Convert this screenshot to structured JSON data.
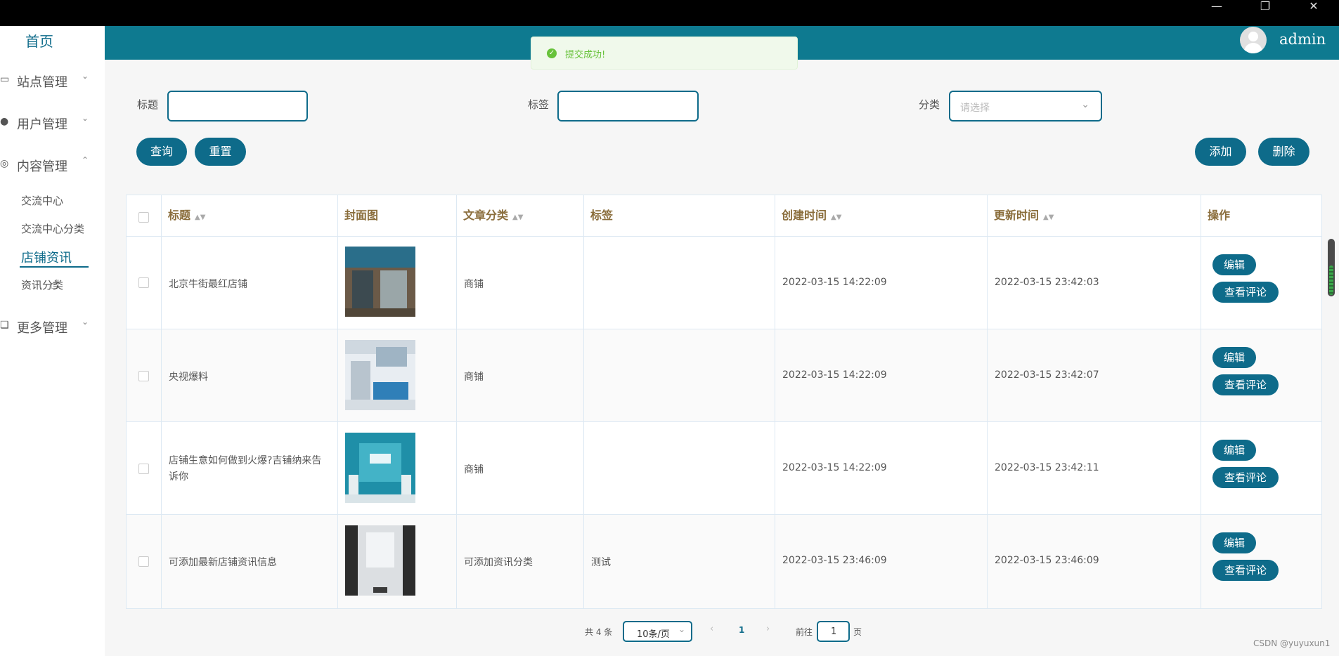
{
  "window": {
    "minimize": "—",
    "restore": "❐",
    "close": "✕"
  },
  "sidebar": {
    "home": "首页",
    "menus": [
      {
        "label": "站点管理",
        "icon": "monitor-icon",
        "glyph": "▭",
        "arrow": "⌄"
      },
      {
        "label": "用户管理",
        "icon": "user-icon",
        "glyph": "●",
        "arrow": "⌄"
      },
      {
        "label": "内容管理",
        "icon": "chat-icon",
        "glyph": "◎",
        "arrow": "⌃"
      },
      {
        "label": "更多管理",
        "icon": "copy-icon",
        "glyph": "❏",
        "arrow": "⌄"
      }
    ],
    "sub_items": [
      "交流中心",
      "交流中心分类",
      "店铺资讯",
      "资讯分类"
    ]
  },
  "header": {
    "user": "admin"
  },
  "toast": {
    "message": "提交成功!"
  },
  "filters": {
    "title_label": "标题",
    "tag_label": "标签",
    "category_label": "分类",
    "category_placeholder": "请选择"
  },
  "buttons": {
    "query": "查询",
    "reset": "重置",
    "add": "添加",
    "delete": "删除"
  },
  "table": {
    "headers": [
      "标题",
      "封面图",
      "文章分类",
      "标签",
      "创建时间",
      "更新时间",
      "操作"
    ],
    "rows": [
      {
        "title": "北京牛街最红店铺",
        "category": "商铺",
        "tag": "",
        "created": "2022-03-15 14:22:09",
        "updated": "2022-03-15 23:42:03"
      },
      {
        "title": "央视爆料",
        "category": "商铺",
        "tag": "",
        "created": "2022-03-15 14:22:09",
        "updated": "2022-03-15 23:42:07"
      },
      {
        "title": "店铺生意如何做到火爆?吉铺纳来告诉你",
        "category": "商铺",
        "tag": "",
        "created": "2022-03-15 14:22:09",
        "updated": "2022-03-15 23:42:11"
      },
      {
        "title": "可添加最新店铺资讯信息",
        "category": "可添加资讯分类",
        "tag": "测试",
        "created": "2022-03-15 23:46:09",
        "updated": "2022-03-15 23:46:09"
      }
    ],
    "edit_label": "编辑",
    "comments_label": "查看评论"
  },
  "pagination": {
    "total": "共 4 条",
    "page_size": "10条/页",
    "current_page": "1",
    "goto_label": "前往",
    "goto_value": "1",
    "page_suffix": "页"
  },
  "watermark": "CSDN @yuyuxun1",
  "colors": {
    "primary": "#0e6b8a",
    "topbar": "#0e7a90",
    "success": "#67c23a",
    "header_text": "#8a6d3b"
  }
}
